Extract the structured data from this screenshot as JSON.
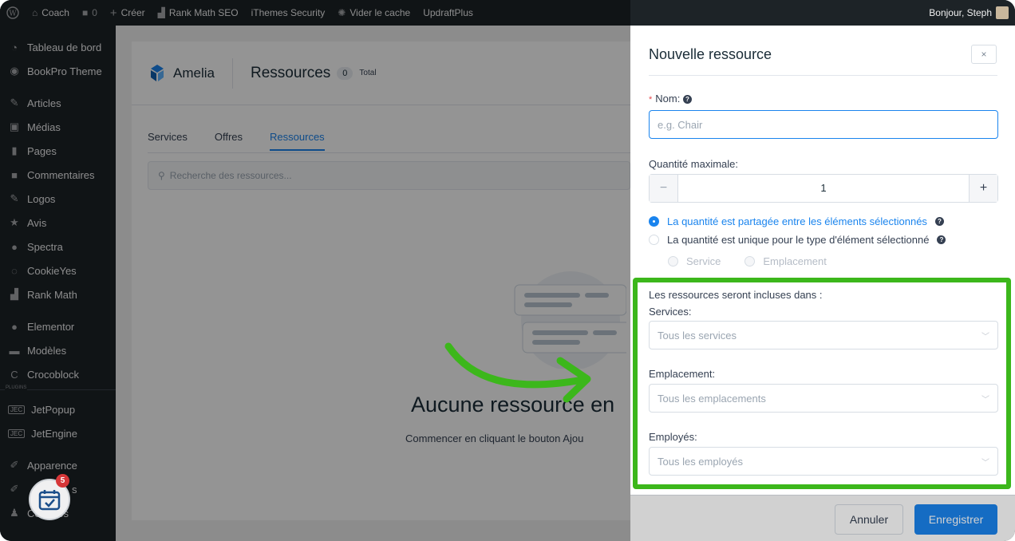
{
  "adminbar": {
    "site_name": "Coach",
    "comments_count": "0",
    "create": "Créer",
    "rank_math": "Rank Math SEO",
    "ithemes": "iThemes Security",
    "cache": "Vider le cache",
    "updraft": "UpdraftPlus",
    "greeting": "Bonjour, Steph"
  },
  "sidebar": {
    "items": [
      {
        "label": "Tableau de bord",
        "icon": "dashboard-icon"
      },
      {
        "label": "BookPro Theme",
        "icon": "theme-icon"
      },
      {
        "label": "Articles",
        "icon": "pin-icon"
      },
      {
        "label": "Médias",
        "icon": "media-icon"
      },
      {
        "label": "Pages",
        "icon": "pages-icon"
      },
      {
        "label": "Commentaires",
        "icon": "comments-icon"
      },
      {
        "label": "Logos",
        "icon": "pin-icon"
      },
      {
        "label": "Avis",
        "icon": "star-icon"
      },
      {
        "label": "Spectra",
        "icon": "spectra-icon"
      },
      {
        "label": "CookieYes",
        "icon": "cookie-icon"
      },
      {
        "label": "Rank Math",
        "icon": "chart-icon"
      },
      {
        "label": "Elementor",
        "icon": "elementor-icon"
      },
      {
        "label": "Modèles",
        "icon": "folder-icon"
      },
      {
        "label": "Crocoblock",
        "icon": "crocoblock-icon"
      },
      {
        "label": "JetPopup",
        "icon": "jet-icon"
      },
      {
        "label": "JetEngine",
        "icon": "jet-icon"
      },
      {
        "label": "Apparence",
        "icon": "brush-icon"
      },
      {
        "label": "Extensions",
        "icon": "plugin-icon"
      },
      {
        "label": "Comptes",
        "icon": "user-icon"
      }
    ],
    "plugins_sep": "PLUGINS",
    "extensions_visible": "s",
    "notification_count": "5"
  },
  "amelia": {
    "brand": "Amelia",
    "page_title": "Ressources",
    "count": "0",
    "total_label": "Total",
    "tabs": [
      "Services",
      "Offres",
      "Ressources"
    ],
    "search_placeholder": "Recherche des ressources...",
    "empty_title": "Aucune ressource en",
    "empty_sub": "Commencer en cliquant le bouton Ajou"
  },
  "drawer": {
    "title": "Nouvelle ressource",
    "close": "×",
    "name_label": "Nom:",
    "name_placeholder": "e.g. Chair",
    "qty_label": "Quantité maximale:",
    "qty_value": "1",
    "minus": "−",
    "plus": "+",
    "radio_shared": "La quantité est partagée entre les éléments sélectionnés",
    "radio_unique": "La quantité est unique pour le type d'élément sélectionné",
    "sub_service": "Service",
    "sub_location": "Emplacement",
    "included_label": "Les ressources seront incluses dans :",
    "services_label": "Services:",
    "services_placeholder": "Tous les services",
    "location_label": "Emplacement:",
    "location_placeholder": "Tous les emplacements",
    "employees_label": "Employés:",
    "employees_placeholder": "Tous les employés",
    "cancel": "Annuler",
    "save": "Enregistrer"
  },
  "colors": {
    "accent": "#1a84ee",
    "highlight": "#3cb71b",
    "wp_dark": "#1d2327"
  }
}
